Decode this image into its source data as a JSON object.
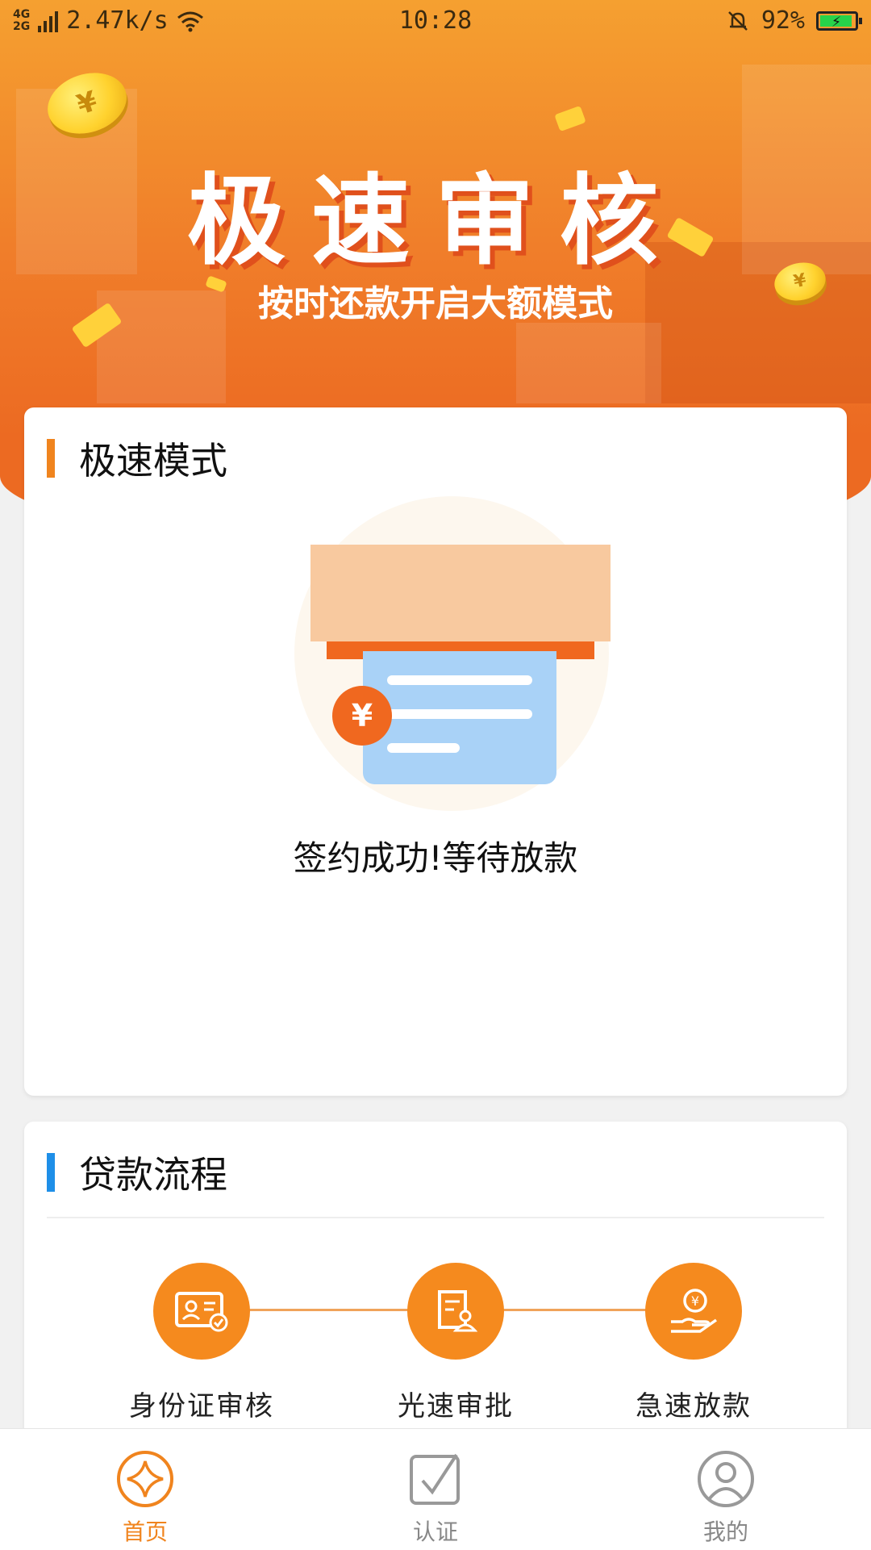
{
  "status_bar": {
    "network_top": "4G",
    "network_bottom": "2G",
    "speed": "2.47k/s",
    "time": "10:28",
    "battery": "92%",
    "icons": [
      "signal-icon",
      "wifi-icon",
      "bell-muted-icon",
      "battery-charging-icon"
    ]
  },
  "hero": {
    "title": "极速审核",
    "subtitle": "按时还款开启大额模式",
    "coin_symbol": "¥"
  },
  "mode_card": {
    "title": "极速模式",
    "illustration_symbol": "¥",
    "status_text": "签约成功!等待放款"
  },
  "flow_card": {
    "title": "贷款流程",
    "steps": [
      {
        "label": "身份证审核",
        "icon": "id-card-icon"
      },
      {
        "label": "光速审批",
        "icon": "approval-doc-icon"
      },
      {
        "label": "急速放款",
        "icon": "hand-money-icon"
      }
    ]
  },
  "bottom_nav": {
    "items": [
      {
        "label": "首页",
        "icon": "home-star-icon",
        "active": true
      },
      {
        "label": "认证",
        "icon": "check-square-icon",
        "active": false
      },
      {
        "label": "我的",
        "icon": "user-icon",
        "active": false
      }
    ]
  },
  "colors": {
    "accent": "#f0841e",
    "hero_top": "#f5a030",
    "hero_bottom": "#ec6a22",
    "flow_bar": "#1e8fe8"
  }
}
